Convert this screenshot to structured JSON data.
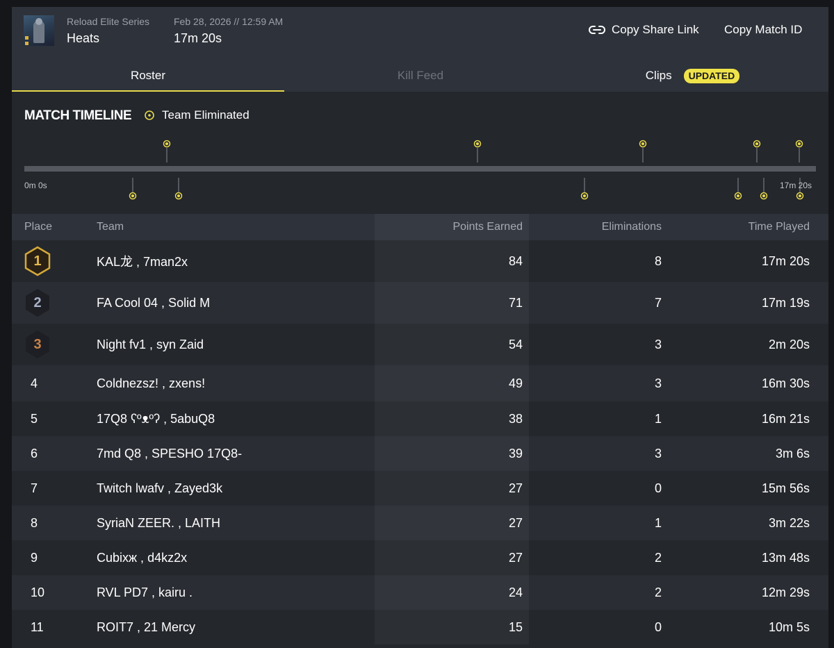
{
  "header": {
    "series": "Reload Elite Series",
    "event": "Heats",
    "datetime": "Feb 28, 2026 // 12:59 AM",
    "duration": "17m 20s",
    "copy_share_link": "Copy Share Link",
    "copy_match_id": "Copy Match ID"
  },
  "tabs": [
    {
      "label": "Roster",
      "state": "active"
    },
    {
      "label": "Kill Feed",
      "state": "disabled"
    },
    {
      "label": "Clips",
      "state": "normal",
      "badge": "UPDATED"
    }
  ],
  "timeline": {
    "title": "MATCH TIMELINE",
    "legend": "Team Eliminated",
    "start_label": "0m 0s",
    "end_label": "17m 20s"
  },
  "table": {
    "columns": [
      "Place",
      "Team",
      "Points Earned",
      "Eliminations",
      "Time Played"
    ],
    "rows": [
      {
        "place": "1",
        "team": "KAL龙 , 7man2x",
        "points": "84",
        "elims": "8",
        "time": "17m 20s"
      },
      {
        "place": "2",
        "team": "FA Cool 04 , Solid M",
        "points": "71",
        "elims": "7",
        "time": "17m 19s"
      },
      {
        "place": "3",
        "team": "Night fv1 , syn Zaid",
        "points": "54",
        "elims": "3",
        "time": "2m 20s"
      },
      {
        "place": "4",
        "team": "Coldnezsz! , zxens!",
        "points": "49",
        "elims": "3",
        "time": "16m 30s"
      },
      {
        "place": "5",
        "team": "17Q8 ʕºᴥºʔ , 5abuQ8",
        "points": "38",
        "elims": "1",
        "time": "16m 21s"
      },
      {
        "place": "6",
        "team": "7md Q8 , SPESHO 17Q8-",
        "points": "39",
        "elims": "3",
        "time": "3m 6s"
      },
      {
        "place": "7",
        "team": "Twitch lwafv , Zayed3k",
        "points": "27",
        "elims": "0",
        "time": "15m 56s"
      },
      {
        "place": "8",
        "team": "SyriaN ZEER. , LAITH",
        "points": "27",
        "elims": "1",
        "time": "3m 22s"
      },
      {
        "place": "9",
        "team": "Cubixж , d4kz2x",
        "points": "27",
        "elims": "2",
        "time": "13m 48s"
      },
      {
        "place": "10",
        "team": "RVL PD7 , kairu .",
        "points": "24",
        "elims": "2",
        "time": "12m 29s"
      },
      {
        "place": "11",
        "team": "ROIT7 , 21 Mercy",
        "points": "15",
        "elims": "0",
        "time": "10m 5s"
      }
    ]
  },
  "colors": {
    "accent": "#e7d94b",
    "gold": "#d4a93a",
    "silver": "#8d96a8",
    "bronze": "#c07a45"
  }
}
